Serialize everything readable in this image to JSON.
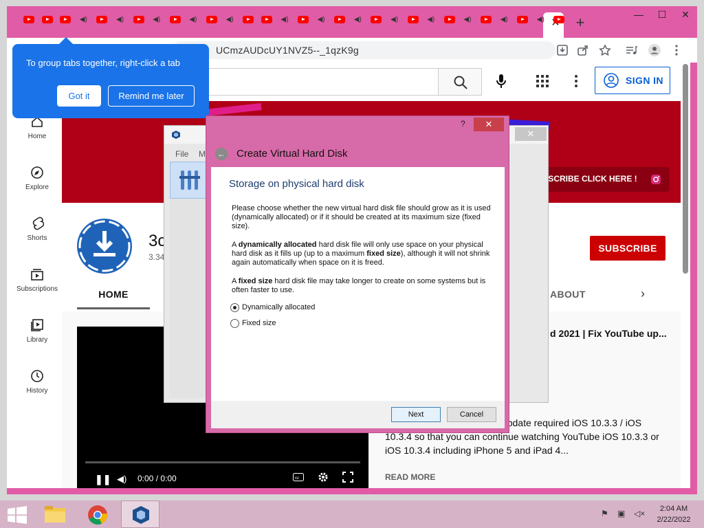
{
  "browser": {
    "url": "UCmzAUDcUY1NVZ5--_1qzK9g",
    "new_tab": "+",
    "close_tab": "✕",
    "win_minimize": "—",
    "win_maximize": "☐",
    "win_close": "✕"
  },
  "tabs": [
    "yt",
    "yt",
    "yt",
    "spk",
    "yt",
    "spk",
    "yt",
    "spk",
    "yt",
    "spk",
    "yt",
    "spk",
    "yt",
    "yt",
    "spk",
    "yt",
    "spk",
    "yt",
    "spk",
    "yt",
    "spk",
    "yt",
    "spk",
    "yt",
    "spk",
    "yt",
    "spk",
    "yt",
    "spk",
    "yt"
  ],
  "tooltip": {
    "text": "To group tabs together, right-click a tab",
    "got_it": "Got it",
    "remind_later": "Remind me later"
  },
  "youtube": {
    "search_placeholder": "h",
    "sign_in": "SIGN IN",
    "nav": [
      {
        "label": "Home",
        "icon": "home-icon"
      },
      {
        "label": "Explore",
        "icon": "compass-icon"
      },
      {
        "label": "Shorts",
        "icon": "shorts-icon"
      },
      {
        "label": "Subscriptions",
        "icon": "subscriptions-icon"
      },
      {
        "label": "Library",
        "icon": "library-icon"
      },
      {
        "label": "History",
        "icon": "history-icon"
      }
    ],
    "banner_cta": "UBSCRIBE CLICK HERE !",
    "channel_name": "3c",
    "channel_subs": "3.34",
    "subscribe": "SUBSCRIBE",
    "tab_home": "HOME",
    "tab_about": "ABOUT",
    "video_title": "d 2021 | Fix YouTube up...",
    "video_time": "0:00 / 0:00",
    "video_desc": "ow you how to fix YouTube update required iOS 10.3.3 / iOS 10.3.4 so that you can continue watching YouTube iOS 10.3.3 or iOS 10.3.4 including iPhone 5 and iPad 4...",
    "read_more": "READ MORE"
  },
  "vbox_manager": {
    "menu_file": "File",
    "menu_m": "M"
  },
  "dialog": {
    "help": "?",
    "close": "✕",
    "title": "Create Virtual Hard Disk",
    "heading": "Storage on physical hard disk",
    "para1": "Please choose whether the new virtual hard disk file should grow as it is used (dynamically allocated) or if it should be created at its maximum size (fixed size).",
    "para2_bold": "dynamically allocated",
    "para2_a": "A ",
    "para2_b": " hard disk file will only use space on your physical hard disk as it fills up (up to a maximum ",
    "para2_bold2": "fixed size",
    "para2_c": "), although it will not shrink again automatically when space on it is freed.",
    "para3_a": "A ",
    "para3_bold": "fixed size",
    "para3_b": " hard disk file may take longer to create on some systems but is often faster to use.",
    "option_dynamic": "Dynamically allocated",
    "option_fixed": "Fixed size",
    "selected": "dynamic",
    "next": "Next",
    "cancel": "Cancel"
  },
  "taskbar": {
    "time": "2:04 AM",
    "date": "2/22/2022"
  },
  "colors": {
    "window_frame": "#e05ca6",
    "accent_blue": "#1a73e8",
    "youtube_red": "#cc0000",
    "banner_red": "#b00017",
    "taskbar": "#d7b3c7"
  }
}
